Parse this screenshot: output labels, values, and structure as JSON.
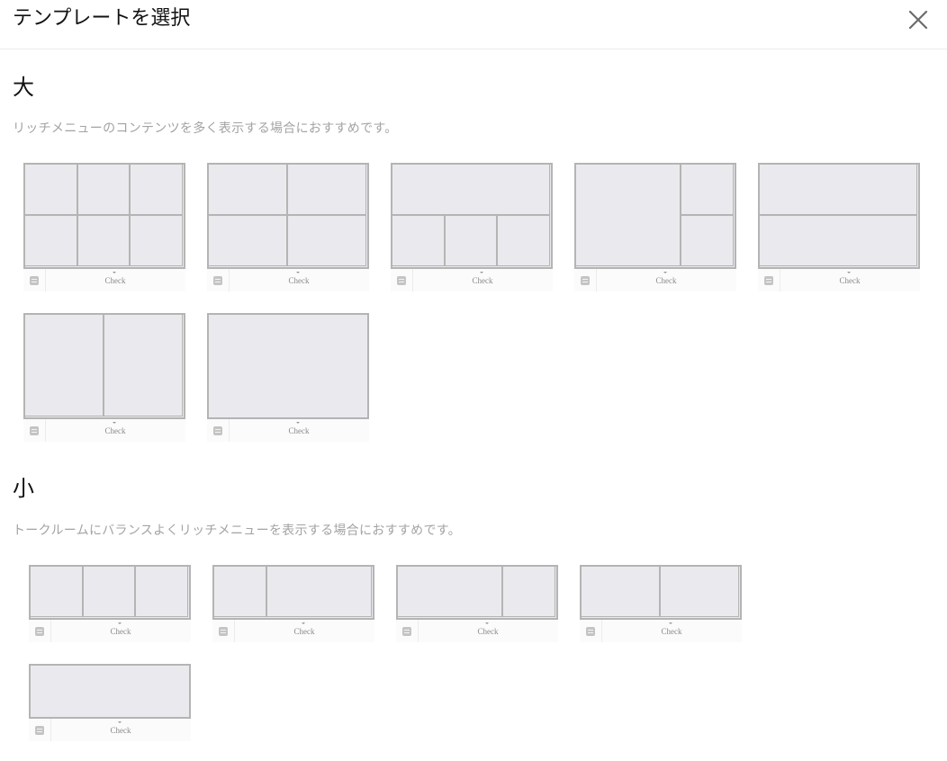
{
  "header": {
    "title": "テンプレートを選択",
    "close_icon": "close-icon"
  },
  "large": {
    "title": "大",
    "description": "リッチメニューのコンテンツを多く表示する場合におすすめです。",
    "templates": [
      {
        "label": "Check",
        "layout": "6 areas (3 columns × 2 rows)"
      },
      {
        "label": "Check",
        "layout": "4 areas (2 columns × 2 rows)"
      },
      {
        "label": "Check",
        "layout": "1 wide top + 3 bottom"
      },
      {
        "label": "Check",
        "layout": "1 large left + 2 stacked right"
      },
      {
        "label": "Check",
        "layout": "2 rows"
      },
      {
        "label": "Check",
        "layout": "2 columns"
      },
      {
        "label": "Check",
        "layout": "1 area"
      }
    ]
  },
  "small": {
    "title": "小",
    "description": "トークルームにバランスよくリッチメニューを表示する場合におすすめです。",
    "templates": [
      {
        "label": "Check",
        "layout": "3 columns"
      },
      {
        "label": "Check",
        "layout": "narrow left + wide right"
      },
      {
        "label": "Check",
        "layout": "wide left + narrow right"
      },
      {
        "label": "Check",
        "layout": "2 columns"
      },
      {
        "label": "Check",
        "layout": "1 area"
      }
    ]
  },
  "icons": {
    "keyboard": "keyboard-icon",
    "caret": "caret-down-icon"
  },
  "colors": {
    "cell_fill": "#eaeaee",
    "cell_border": "#b4b4b4",
    "description": "#a3a3a3"
  }
}
